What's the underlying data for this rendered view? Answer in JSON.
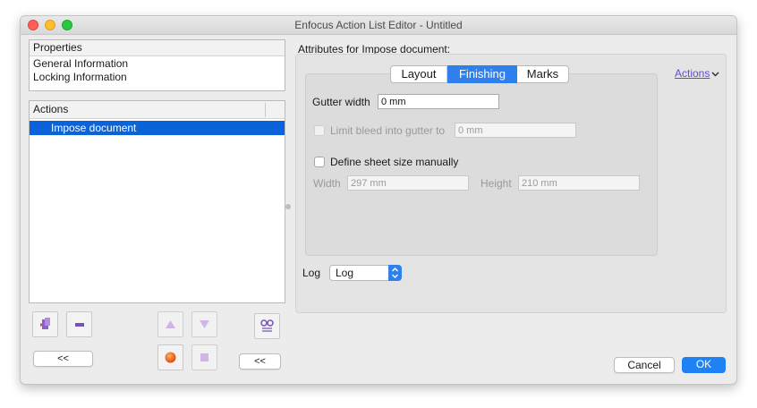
{
  "window": {
    "title": "Enfocus Action List Editor - Untitled"
  },
  "properties": {
    "header": "Properties",
    "items": [
      "General Information",
      "Locking Information"
    ]
  },
  "actions_list": {
    "header": "Actions",
    "items": [
      "Impose document"
    ]
  },
  "left_buttons": {
    "collapse_left": "<<",
    "collapse_right": "<<"
  },
  "attributes": {
    "heading": "Attributes for Impose document:",
    "actions_menu": "Actions",
    "tabs": [
      "Layout",
      "Finishing",
      "Marks"
    ],
    "active_tab": "Finishing",
    "gutter_width_label": "Gutter width",
    "gutter_width_value": "0 mm",
    "limit_bleed_label": "Limit bleed into gutter to",
    "limit_bleed_value": "0 mm",
    "define_sheet_label": "Define sheet size manually",
    "width_label": "Width",
    "width_value": "297 mm",
    "height_label": "Height",
    "height_value": "210 mm",
    "log_label": "Log",
    "log_value": "Log"
  },
  "footer": {
    "cancel": "Cancel",
    "ok": "OK"
  },
  "colors": {
    "accent": "#0a63d9",
    "selection": "#0a63d9",
    "link": "#5b4fd6"
  }
}
